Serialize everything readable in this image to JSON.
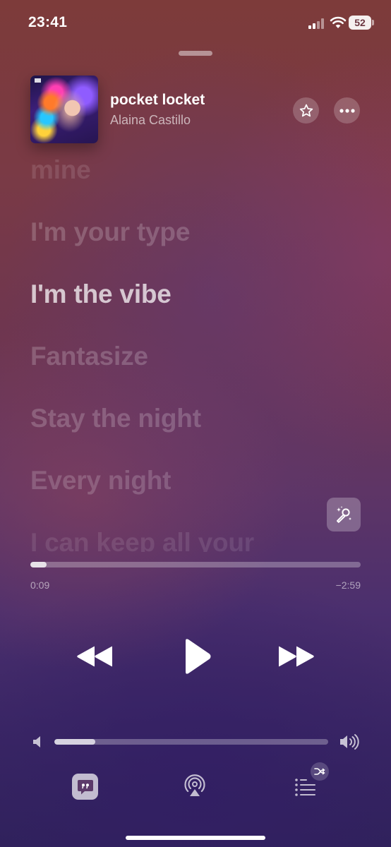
{
  "status_bar": {
    "time": "23:41",
    "battery": "52"
  },
  "now_playing": {
    "title": "pocket locket",
    "artist": "Alaina Castillo",
    "artwork_icon": "album-artwork"
  },
  "lyrics": {
    "lines": [
      "mine",
      "I'm your type",
      "I'm the vibe",
      "Fantasize",
      "Stay the night",
      "Every night",
      "I can keep all your"
    ],
    "active_line_index": 2
  },
  "playback": {
    "elapsed": "0:09",
    "remaining": "−2:59",
    "progress_fraction": 0.05,
    "state": "paused"
  },
  "volume": {
    "level_fraction": 0.15
  },
  "toolbar": {
    "lyrics_icon": "quote-bubble-icon",
    "airplay_icon": "airplay-audio-icon",
    "queue_icon": "playing-next-list-icon",
    "shuffle_icon": "shuffle-icon"
  },
  "colors": {
    "background_top": "#7d3b3a",
    "background_bottom": "#2f225a",
    "text_primary": "#ffffff"
  }
}
